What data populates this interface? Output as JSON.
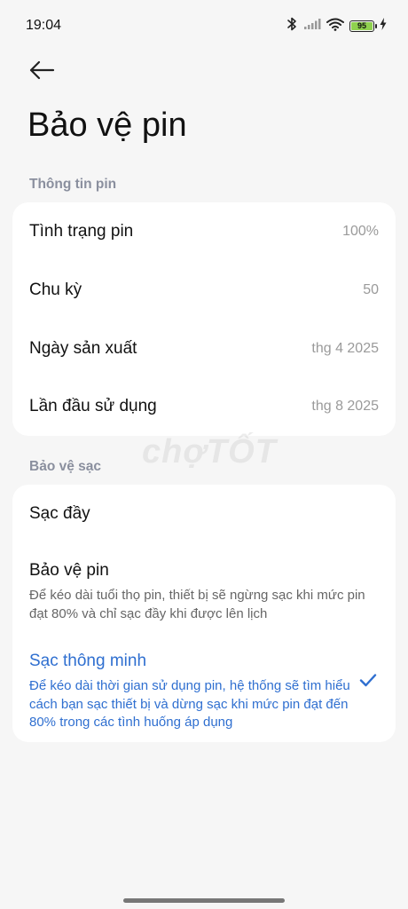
{
  "status_bar": {
    "time": "19:04",
    "battery_level": "95",
    "icons": [
      "bluetooth-icon",
      "signal-icon",
      "wifi-icon",
      "battery-icon",
      "charging-icon"
    ]
  },
  "header": {
    "title": "Bảo vệ pin"
  },
  "battery_info": {
    "section_title": "Thông tin pin",
    "rows": [
      {
        "label": "Tình trạng pin",
        "value": "100%"
      },
      {
        "label": "Chu kỳ",
        "value": "50"
      },
      {
        "label": "Ngày sản xuất",
        "value": "thg 4 2025"
      },
      {
        "label": "Lần đầu sử dụng",
        "value": "thg 8 2025"
      }
    ]
  },
  "charge_protection": {
    "section_title": "Bảo vệ sạc",
    "options": [
      {
        "title": "Sạc đầy",
        "description": "",
        "selected": false
      },
      {
        "title": "Bảo vệ pin",
        "description": "Để kéo dài tuổi thọ pin, thiết bị sẽ ngừng sạc khi mức pin đạt 80% và chỉ sạc đầy khi được lên lịch",
        "selected": false
      },
      {
        "title": "Sạc thông minh",
        "description": "Để kéo dài thời gian sử dụng pin, hệ thống sẽ tìm hiểu cách bạn sạc thiết bị và dừng sạc khi mức pin đạt đến 80% trong các tình huống áp dụng",
        "selected": true
      }
    ]
  },
  "watermark": "chợTỐT",
  "colors": {
    "accent": "#2f6fd0",
    "background": "#f6f6f6",
    "card": "#ffffff",
    "section_header": "#8a8f9e",
    "battery_fill": "#8fd14f"
  }
}
